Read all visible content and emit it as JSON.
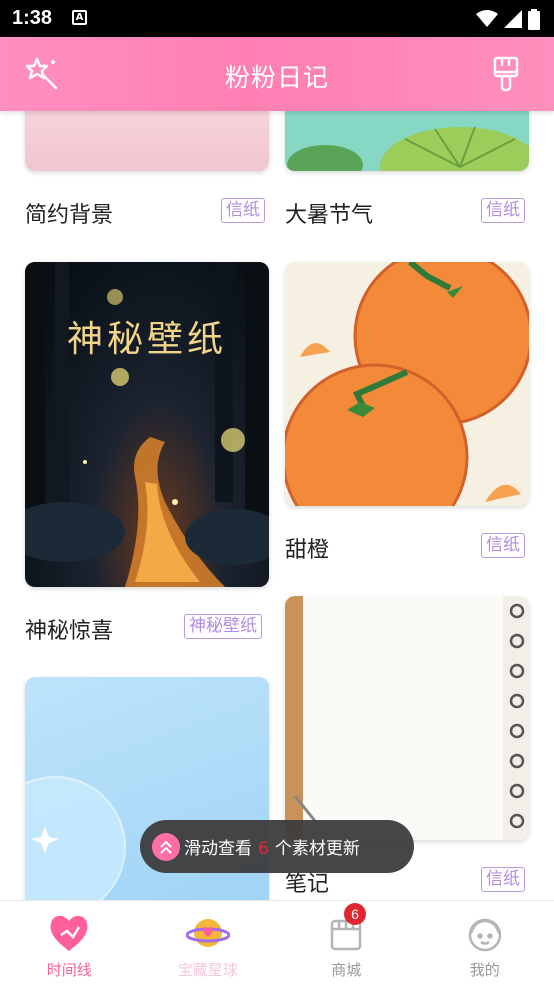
{
  "status_bar": {
    "time": "1:38",
    "notification_icon": "A"
  },
  "header": {
    "title": "粉粉日记",
    "left_icon": "magic-wand-icon",
    "right_icon": "paint-brush-icon"
  },
  "cards": [
    {
      "title": "简约背景",
      "tag": "信纸"
    },
    {
      "title": "大暑节气",
      "tag": "信纸"
    },
    {
      "title": "神秘惊喜",
      "tag": "神秘壁纸",
      "image_text": "神秘壁纸"
    },
    {
      "title": "甜橙",
      "tag": "信纸"
    },
    {
      "title": "笔记",
      "tag": "信纸"
    },
    {
      "title": "",
      "tag": ""
    }
  ],
  "toast": {
    "prefix": "滑动查看",
    "count": "6",
    "suffix": "个素材更新"
  },
  "tabs": [
    {
      "label": "时间线",
      "icon": "heart-timeline-icon",
      "active": true
    },
    {
      "label": "宝藏星球",
      "icon": "planet-icon",
      "active": false
    },
    {
      "label": "商城",
      "icon": "shop-icon",
      "active": false,
      "badge": "6"
    },
    {
      "label": "我的",
      "icon": "profile-icon",
      "active": false
    }
  ],
  "colors": {
    "accent": "#ff7fb3",
    "tag": "#b08ee0",
    "badge": "#e0262f"
  }
}
